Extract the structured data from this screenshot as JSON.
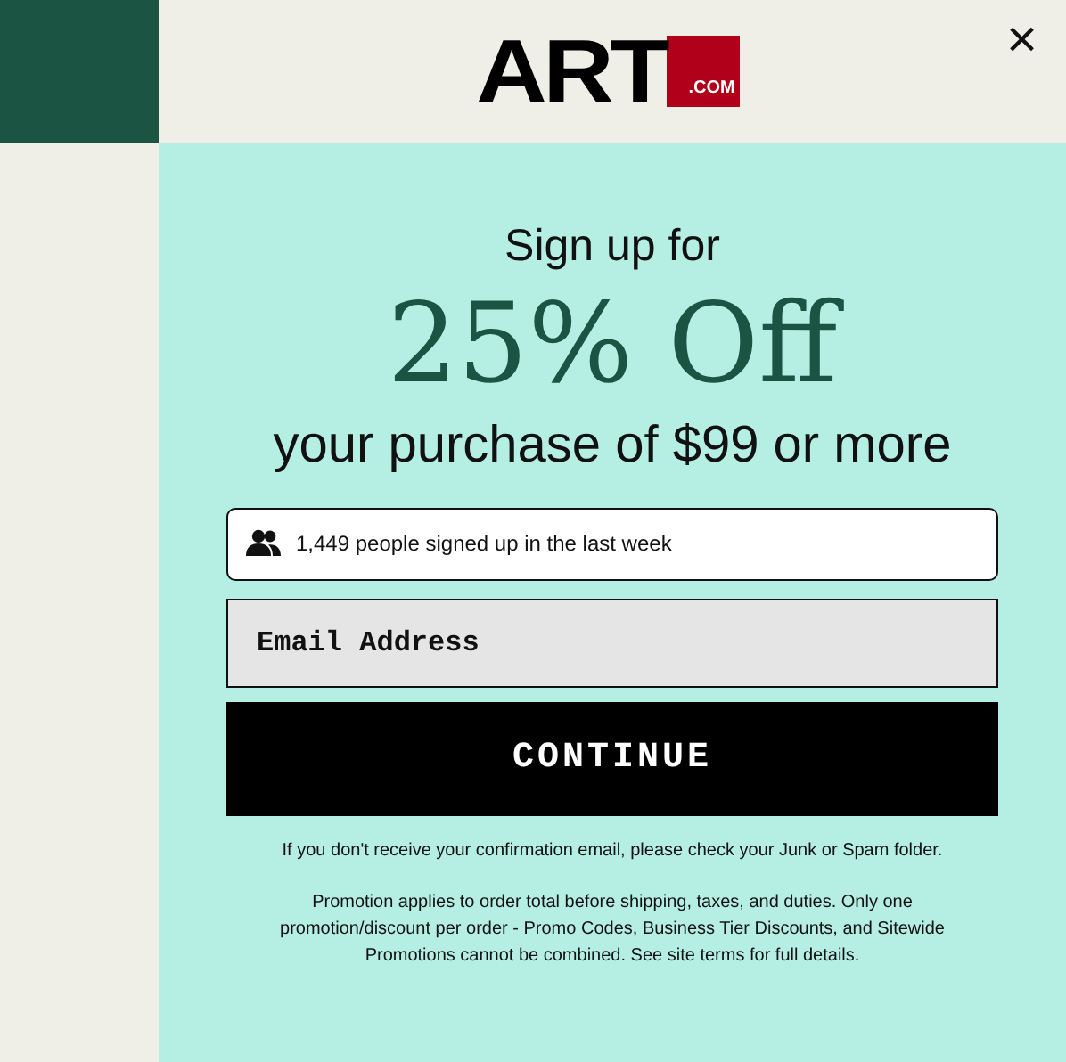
{
  "logo": {
    "word": "ART",
    "suffix": ".COM"
  },
  "close": "×",
  "headline": {
    "intro": "Sign up for",
    "offer": "25% Off",
    "condition": "your purchase of $99 or more"
  },
  "social_proof": "1,449 people signed up in the last week",
  "email": {
    "placeholder": "Email Address"
  },
  "button": "CONTINUE",
  "notice": "If you don't receive your confirmation email, please check your Junk or Spam folder.",
  "terms": "Promotion applies to order total before shipping, taxes, and duties. Only one promotion/discount per order - Promo Codes, Business Tier Discounts, and Sitewide Promotions cannot be combined. See site terms for full details."
}
